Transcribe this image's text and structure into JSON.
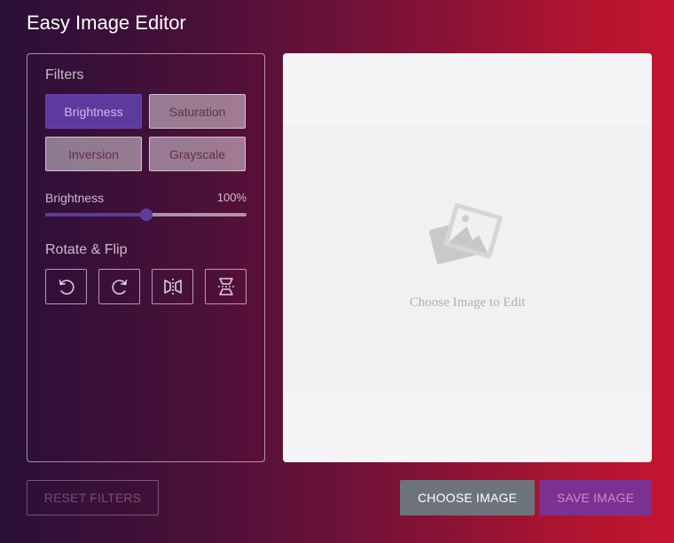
{
  "app": {
    "title": "Easy Image Editor"
  },
  "filters": {
    "title": "Filters",
    "buttons": [
      {
        "label": "Brightness",
        "active": true
      },
      {
        "label": "Saturation",
        "active": false
      },
      {
        "label": "Inversion",
        "active": false
      },
      {
        "label": "Grayscale",
        "active": false
      }
    ],
    "slider": {
      "label": "Brightness",
      "value_text": "100%",
      "value": 100,
      "max": 200
    }
  },
  "rotate_flip": {
    "title": "Rotate & Flip",
    "tools": [
      {
        "icon": "rotate-left-icon"
      },
      {
        "icon": "rotate-right-icon"
      },
      {
        "icon": "flip-horizontal-icon"
      },
      {
        "icon": "flip-vertical-icon"
      }
    ]
  },
  "preview": {
    "placeholder_text": "Choose Image to Edit",
    "placeholder_icon": "image-placeholder-icon"
  },
  "actions": {
    "reset_label": "RESET FILTERS",
    "choose_label": "CHOOSE IMAGE",
    "save_label": "SAVE IMAGE"
  },
  "colors": {
    "accent": "#5d3b9e",
    "save_button": "#7a3192",
    "choose_button": "#6c737b",
    "gradient_start": "#2a0f37",
    "gradient_end": "#c41531"
  }
}
